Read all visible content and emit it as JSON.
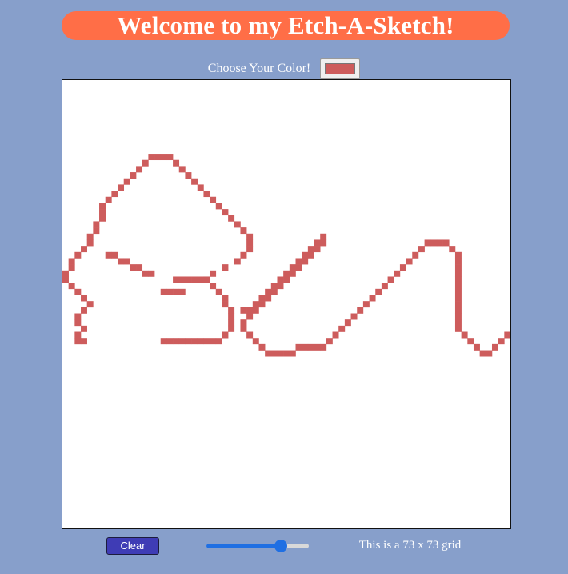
{
  "header": {
    "title": "Welcome to my Etch-A-Sketch!",
    "banner_color": "#ff6e47",
    "background_color": "#879fcb"
  },
  "color_picker": {
    "label": "Choose Your Color!",
    "selected_color": "#cd5c5c"
  },
  "grid": {
    "columns": 73,
    "rows": 73,
    "background_color": "#ffffff",
    "ink_color": "#cd5c5c",
    "drawing_text": "Ben",
    "painted_cells": [
      [
        14,
        0
      ],
      [
        15,
        0
      ],
      [
        16,
        0
      ],
      [
        17,
        0
      ],
      [
        13,
        1
      ],
      [
        18,
        1
      ],
      [
        12,
        2
      ],
      [
        19,
        2
      ],
      [
        11,
        3
      ],
      [
        20,
        3
      ],
      [
        10,
        4
      ],
      [
        21,
        4
      ],
      [
        9,
        5
      ],
      [
        22,
        5
      ],
      [
        8,
        6
      ],
      [
        23,
        6
      ],
      [
        7,
        7
      ],
      [
        24,
        7
      ],
      [
        6,
        8
      ],
      [
        25,
        8
      ],
      [
        6,
        9
      ],
      [
        26,
        9
      ],
      [
        6,
        10
      ],
      [
        27,
        10
      ],
      [
        5,
        11
      ],
      [
        28,
        11
      ],
      [
        5,
        12
      ],
      [
        29,
        12
      ],
      [
        4,
        13
      ],
      [
        30,
        13
      ],
      [
        4,
        14
      ],
      [
        30,
        14
      ],
      [
        3,
        15
      ],
      [
        30,
        15
      ],
      [
        2,
        16
      ],
      [
        29,
        16
      ],
      [
        1,
        17
      ],
      [
        28,
        17
      ],
      [
        1,
        18
      ],
      [
        26,
        18
      ],
      [
        0,
        19
      ],
      [
        24,
        19
      ],
      [
        0,
        20
      ],
      [
        23,
        20
      ],
      [
        1,
        21
      ],
      [
        2,
        22
      ],
      [
        3,
        23
      ],
      [
        4,
        24
      ],
      [
        3,
        25
      ],
      [
        2,
        26
      ],
      [
        2,
        27
      ],
      [
        3,
        28
      ],
      [
        2,
        29
      ],
      [
        2,
        30
      ],
      [
        3,
        30
      ],
      [
        7,
        16
      ],
      [
        8,
        16
      ],
      [
        9,
        17
      ],
      [
        10,
        17
      ],
      [
        11,
        18
      ],
      [
        12,
        18
      ],
      [
        13,
        19
      ],
      [
        14,
        19
      ],
      [
        16,
        22
      ],
      [
        17,
        22
      ],
      [
        18,
        22
      ],
      [
        19,
        22
      ],
      [
        18,
        20
      ],
      [
        19,
        20
      ],
      [
        20,
        20
      ],
      [
        21,
        20
      ],
      [
        22,
        20
      ],
      [
        23,
        20
      ],
      [
        24,
        21
      ],
      [
        25,
        22
      ],
      [
        26,
        23
      ],
      [
        26,
        24
      ],
      [
        27,
        25
      ],
      [
        27,
        26
      ],
      [
        27,
        27
      ],
      [
        27,
        28
      ],
      [
        26,
        29
      ],
      [
        25,
        30
      ],
      [
        24,
        30
      ],
      [
        23,
        30
      ],
      [
        22,
        30
      ],
      [
        21,
        30
      ],
      [
        20,
        30
      ],
      [
        19,
        30
      ],
      [
        18,
        30
      ],
      [
        17,
        30
      ],
      [
        16,
        30
      ],
      [
        29,
        25
      ],
      [
        30,
        25
      ],
      [
        31,
        24
      ],
      [
        32,
        23
      ],
      [
        33,
        22
      ],
      [
        34,
        21
      ],
      [
        35,
        20
      ],
      [
        36,
        19
      ],
      [
        37,
        18
      ],
      [
        38,
        17
      ],
      [
        39,
        16
      ],
      [
        40,
        15
      ],
      [
        41,
        14
      ],
      [
        42,
        13
      ],
      [
        42,
        14
      ],
      [
        41,
        15
      ],
      [
        40,
        16
      ],
      [
        39,
        17
      ],
      [
        38,
        18
      ],
      [
        37,
        19
      ],
      [
        36,
        20
      ],
      [
        35,
        21
      ],
      [
        34,
        22
      ],
      [
        33,
        23
      ],
      [
        32,
        24
      ],
      [
        31,
        25
      ],
      [
        30,
        26
      ],
      [
        29,
        27
      ],
      [
        29,
        28
      ],
      [
        30,
        29
      ],
      [
        31,
        30
      ],
      [
        32,
        31
      ],
      [
        33,
        32
      ],
      [
        34,
        32
      ],
      [
        35,
        32
      ],
      [
        36,
        32
      ],
      [
        37,
        32
      ],
      [
        38,
        31
      ],
      [
        39,
        31
      ],
      [
        40,
        31
      ],
      [
        41,
        31
      ],
      [
        42,
        31
      ],
      [
        43,
        30
      ],
      [
        44,
        29
      ],
      [
        45,
        28
      ],
      [
        46,
        27
      ],
      [
        47,
        26
      ],
      [
        48,
        25
      ],
      [
        49,
        24
      ],
      [
        50,
        23
      ],
      [
        51,
        22
      ],
      [
        52,
        21
      ],
      [
        53,
        20
      ],
      [
        54,
        19
      ],
      [
        55,
        18
      ],
      [
        56,
        17
      ],
      [
        57,
        16
      ],
      [
        58,
        15
      ],
      [
        59,
        14
      ],
      [
        60,
        14
      ],
      [
        61,
        14
      ],
      [
        62,
        14
      ],
      [
        63,
        15
      ],
      [
        64,
        16
      ],
      [
        64,
        17
      ],
      [
        64,
        18
      ],
      [
        64,
        19
      ],
      [
        64,
        20
      ],
      [
        64,
        21
      ],
      [
        64,
        22
      ],
      [
        64,
        23
      ],
      [
        64,
        24
      ],
      [
        64,
        25
      ],
      [
        64,
        26
      ],
      [
        64,
        27
      ],
      [
        64,
        28
      ],
      [
        65,
        29
      ],
      [
        66,
        30
      ],
      [
        67,
        31
      ],
      [
        68,
        32
      ],
      [
        69,
        32
      ],
      [
        70,
        31
      ],
      [
        71,
        30
      ],
      [
        72,
        29
      ]
    ]
  },
  "controls": {
    "clear_label": "Clear",
    "slider_value": 73,
    "slider_min": 1,
    "slider_max": 100,
    "grid_info_text": "This is a 73 x 73 grid"
  }
}
